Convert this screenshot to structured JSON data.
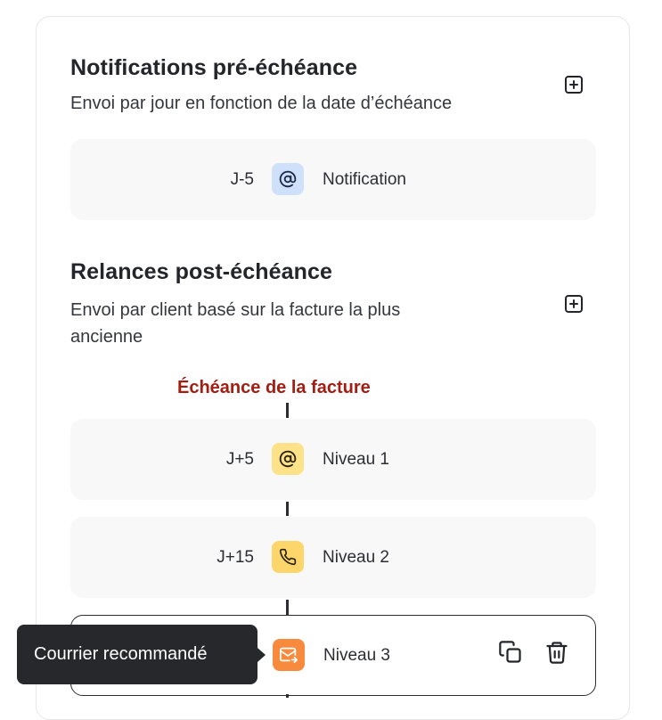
{
  "pre_due": {
    "title": "Notifications pré-échéance",
    "description": "Envoi par jour en fonction de la date d’échéance",
    "add_icon": "plus-square-icon",
    "rows": [
      {
        "day": "J-5",
        "channel_icon": "at-sign-icon",
        "label": "Notification",
        "badge_color": "#cfe0fb",
        "icon_color": "#1f2b44"
      }
    ]
  },
  "post_due": {
    "title": "Relances post-échéance",
    "description_line1": "Envoi par client basé sur la facture la plus",
    "description_line2": "ancienne",
    "add_icon": "plus-square-icon",
    "deadline_label": "Échéance de la facture",
    "rows": [
      {
        "day": "J+5",
        "channel_icon": "at-sign-icon",
        "label": "Niveau 1",
        "badge_color": "#fde28a",
        "icon_color": "#2a2200"
      },
      {
        "day": "J+15",
        "channel_icon": "phone-icon",
        "label": "Niveau 2",
        "badge_color": "#fcd56b",
        "icon_color": "#2a2200"
      },
      {
        "day": "",
        "channel_icon": "mail-send-icon",
        "label": "Niveau 3",
        "badge_color": "#f78a3c",
        "icon_color": "#ffffff"
      }
    ],
    "row_actions": [
      "copy-icon",
      "trash-icon"
    ]
  },
  "tooltip": {
    "text": "Courrier recommandé"
  }
}
